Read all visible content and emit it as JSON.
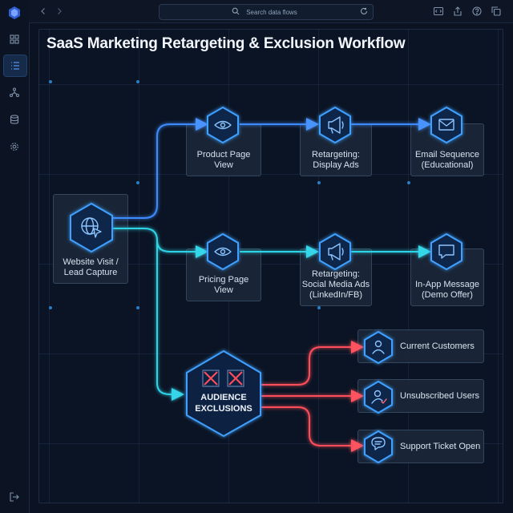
{
  "title": "SaaS Marketing Retargeting & Exclusion Workflow",
  "search": {
    "placeholder": "Search data flows"
  },
  "sidebar": {
    "items": [
      {
        "icon": "grid-icon"
      },
      {
        "icon": "list-icon",
        "active": true
      },
      {
        "icon": "network-icon"
      },
      {
        "icon": "database-icon"
      },
      {
        "icon": "settings-icon"
      }
    ],
    "footer_icon": "logout-icon"
  },
  "toolbar": {
    "icons": [
      "code-icon",
      "share-icon",
      "help-icon",
      "copy-icon"
    ]
  },
  "nodes": {
    "source": "Website Visit /\nLead Capture",
    "product_page": "Product Page\nView",
    "display_ads": "Retargeting:\nDisplay Ads",
    "email_sequence": "Email Sequence\n(Educational)",
    "pricing_page": "Pricing Page\nView",
    "social_ads": "Retargeting:\nSocial Media Ads\n(LinkedIn/FB)",
    "in_app": "In-App Message\n(Demo Offer)",
    "exclusions": "AUDIENCE\nEXCLUSIONS",
    "current_customers": "Current Customers",
    "unsubscribed": "Unsubscribed Users",
    "support_ticket": "Support Ticket Open"
  },
  "colors": {
    "blue_flow": "#3d8bff",
    "cyan_flow": "#2fd3e6",
    "red_flow": "#ff4d5a",
    "node_stroke": "#3fa0ff"
  }
}
